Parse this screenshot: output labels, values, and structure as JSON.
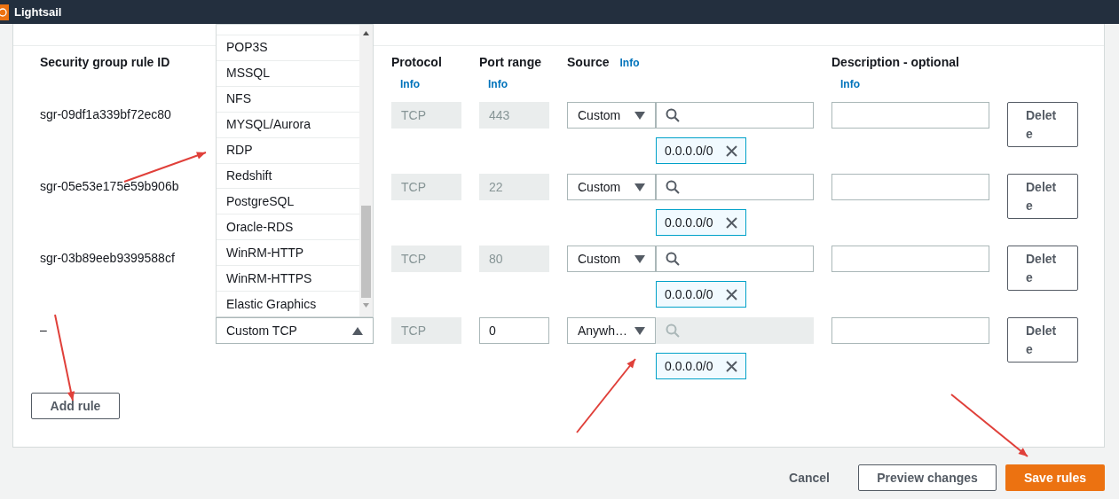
{
  "app": {
    "title": "Lightsail"
  },
  "columns": [
    {
      "label": "Security group rule ID"
    },
    {
      "label": "Protocol",
      "info": "Info",
      "info_inline": false
    },
    {
      "label": "Port range",
      "info": "Info",
      "info_inline": false
    },
    {
      "label": "Source",
      "info": "Info",
      "info_inline": true
    },
    {
      "label": "Description - optional",
      "info": "Info",
      "info_inline": false
    }
  ],
  "rows": [
    {
      "id": "sgr-09df1a339bf72ec80",
      "protocol": "TCP",
      "port": "443",
      "port_editable": false,
      "source": "Custom",
      "search_disabled": false,
      "cidr": "0.0.0.0/0",
      "delete": "Delete"
    },
    {
      "id": "sgr-05e53e175e59b906b",
      "protocol": "TCP",
      "port": "22",
      "port_editable": false,
      "source": "Custom",
      "search_disabled": false,
      "cidr": "0.0.0.0/0",
      "delete": "Delete"
    },
    {
      "id": "sgr-03b89eeb9399588cf",
      "protocol": "TCP",
      "port": "80",
      "port_editable": false,
      "source": "Custom",
      "search_disabled": false,
      "cidr": "0.0.0.0/0",
      "delete": "Delete"
    },
    {
      "id": "–",
      "type": {
        "value": "Custom TCP",
        "expanded": true
      },
      "protocol": "TCP",
      "port": "0",
      "port_editable": true,
      "source": "Anywh…",
      "search_disabled": true,
      "cidr": "0.0.0.0/0",
      "delete": "Delete"
    }
  ],
  "type_options": [
    "POP3S",
    "MSSQL",
    "NFS",
    "MYSQL/Aurora",
    "RDP",
    "Redshift",
    "PostgreSQL",
    "Oracle-RDS",
    "WinRM-HTTP",
    "WinRM-HTTPS",
    "Elastic Graphics"
  ],
  "add_rule": "Add rule",
  "footer": {
    "cancel": "Cancel",
    "preview": "Preview changes",
    "save": "Save rules"
  }
}
